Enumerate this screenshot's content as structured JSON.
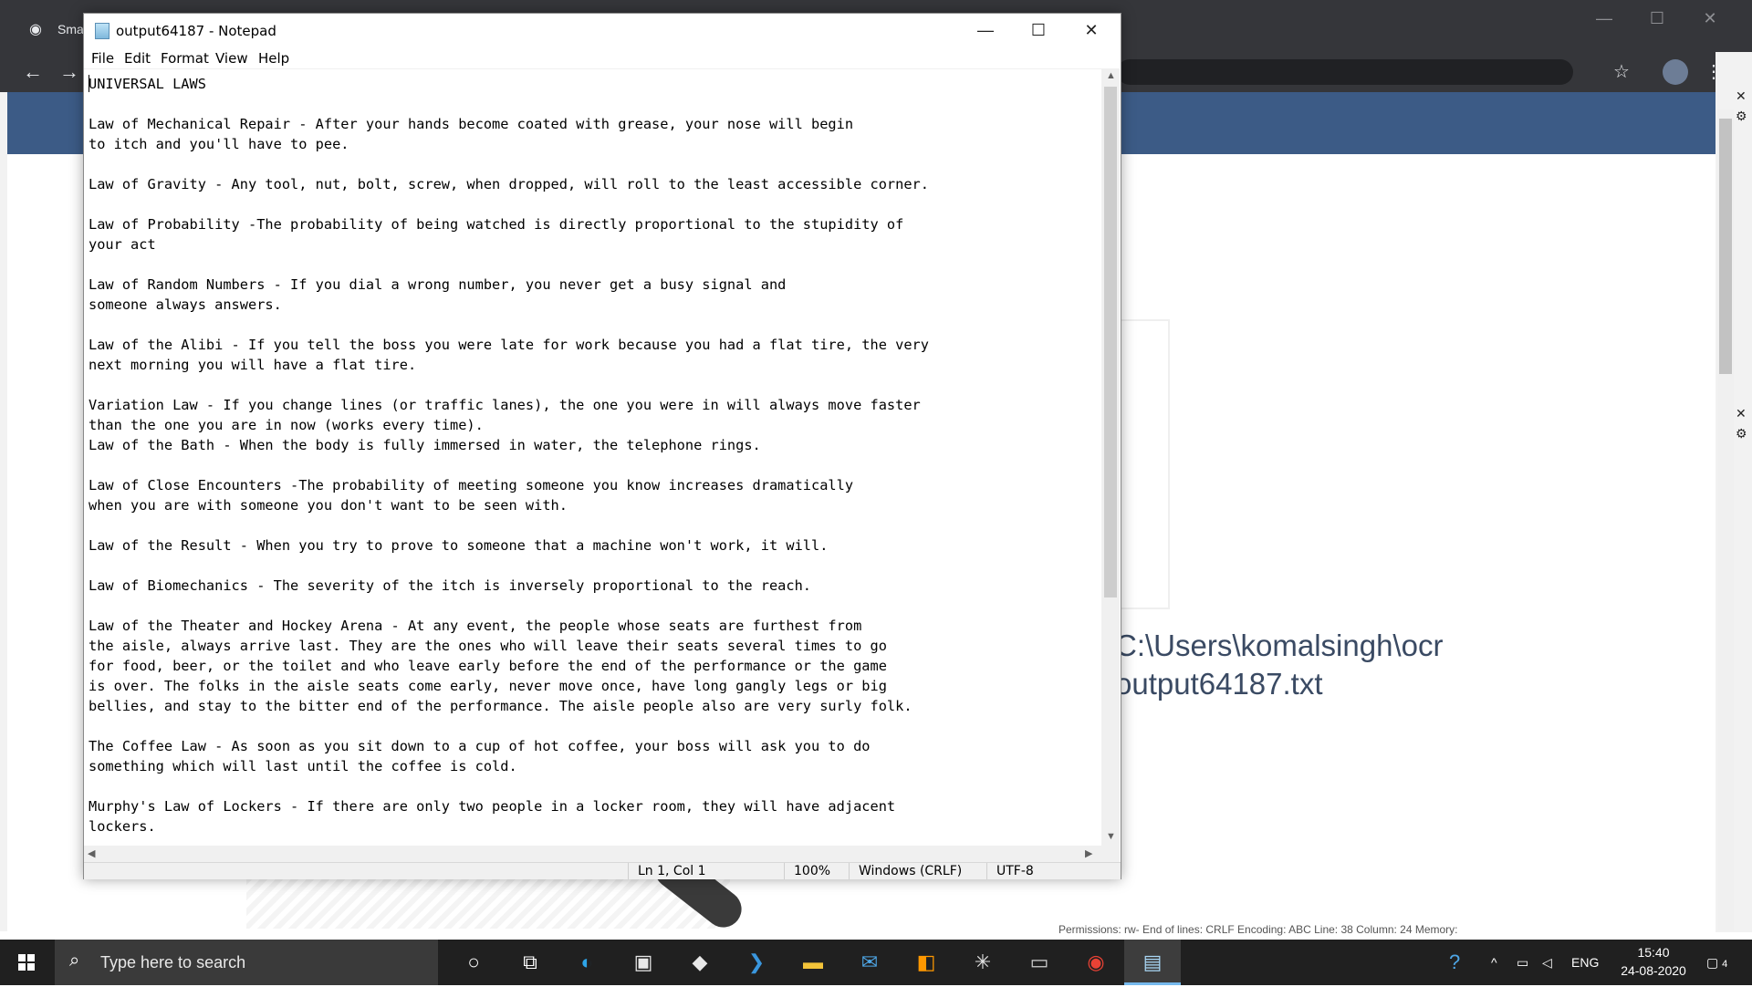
{
  "browser": {
    "tab_title": "Sma",
    "window_controls": {
      "minimize": "—",
      "maximize": "☐",
      "close": "✕"
    },
    "back_icon": "←",
    "forward_icon": "→",
    "star_icon": "☆",
    "menu_icon": "⋮",
    "path_text_line1": "C:\\Users\\komalsingh\\ocr",
    "path_text_line2": "output64187.txt",
    "statusline": "Permissions: rw-     End of lines: CRLF     Encoding: ABC     Line: 38     Column: 24     Memory:"
  },
  "notepad": {
    "title": "output64187 - Notepad",
    "controls": {
      "minimize": "—",
      "maximize": "☐",
      "close": "✕"
    },
    "menu": [
      "File",
      "Edit",
      "Format",
      "View",
      "Help"
    ],
    "text": "UNIVERSAL LAWS\n\nLaw of Mechanical Repair - After your hands become coated with grease, your nose will begin\nto itch and you'll have to pee.\n\nLaw of Gravity - Any tool, nut, bolt, screw, when dropped, will roll to the least accessible corner.\n\nLaw of Probability -The probability of being watched is directly proportional to the stupidity of\nyour act\n\nLaw of Random Numbers - If you dial a wrong number, you never get a busy signal and\nsomeone always answers.\n\nLaw of the Alibi - If you tell the boss you were late for work because you had a flat tire, the very\nnext morning you will have a flat tire.\n\nVariation Law - If you change lines (or traffic lanes), the one you were in will always move faster\nthan the one you are in now (works every time).\nLaw of the Bath - When the body is fully immersed in water, the telephone rings.\n\nLaw of Close Encounters -The probability of meeting someone you know increases dramatically\nwhen you are with someone you don't want to be seen with.\n\nLaw of the Result - When you try to prove to someone that a machine won't work, it will.\n\nLaw of Biomechanics - The severity of the itch is inversely proportional to the reach.\n\nLaw of the Theater and Hockey Arena - At any event, the people whose seats are furthest from\nthe aisle, always arrive last. They are the ones who will leave their seats several times to go\nfor food, beer, or the toilet and who leave early before the end of the performance or the game\nis over. The folks in the aisle seats come early, never move once, have long gangly legs or big\nbellies, and stay to the bitter end of the performance. The aisle people also are very surly folk.\n\nThe Coffee Law - As soon as you sit down to a cup of hot coffee, your boss will ask you to do\nsomething which will last until the coffee is cold.\n\nMurphy's Law of Lockers - If there are only two people in a locker room, they will have adjacent\nlockers.",
    "status": {
      "position": "Ln 1, Col 1",
      "zoom": "100%",
      "line_endings": "Windows (CRLF)",
      "encoding": "UTF-8"
    }
  },
  "taskbar": {
    "search_placeholder": "Type here to search",
    "icons": [
      "cortana-icon",
      "task-view-icon",
      "edge-icon",
      "store-icon",
      "dropbox-icon",
      "powershell-icon",
      "file-explorer-icon",
      "mail-icon",
      "sublime-icon",
      "spider-app-icon",
      "terminal-icon",
      "chrome-icon",
      "notepad-icon"
    ],
    "tray": {
      "language": "ENG",
      "time": "15:40",
      "date": "24-08-2020",
      "notification_count": "4"
    }
  }
}
